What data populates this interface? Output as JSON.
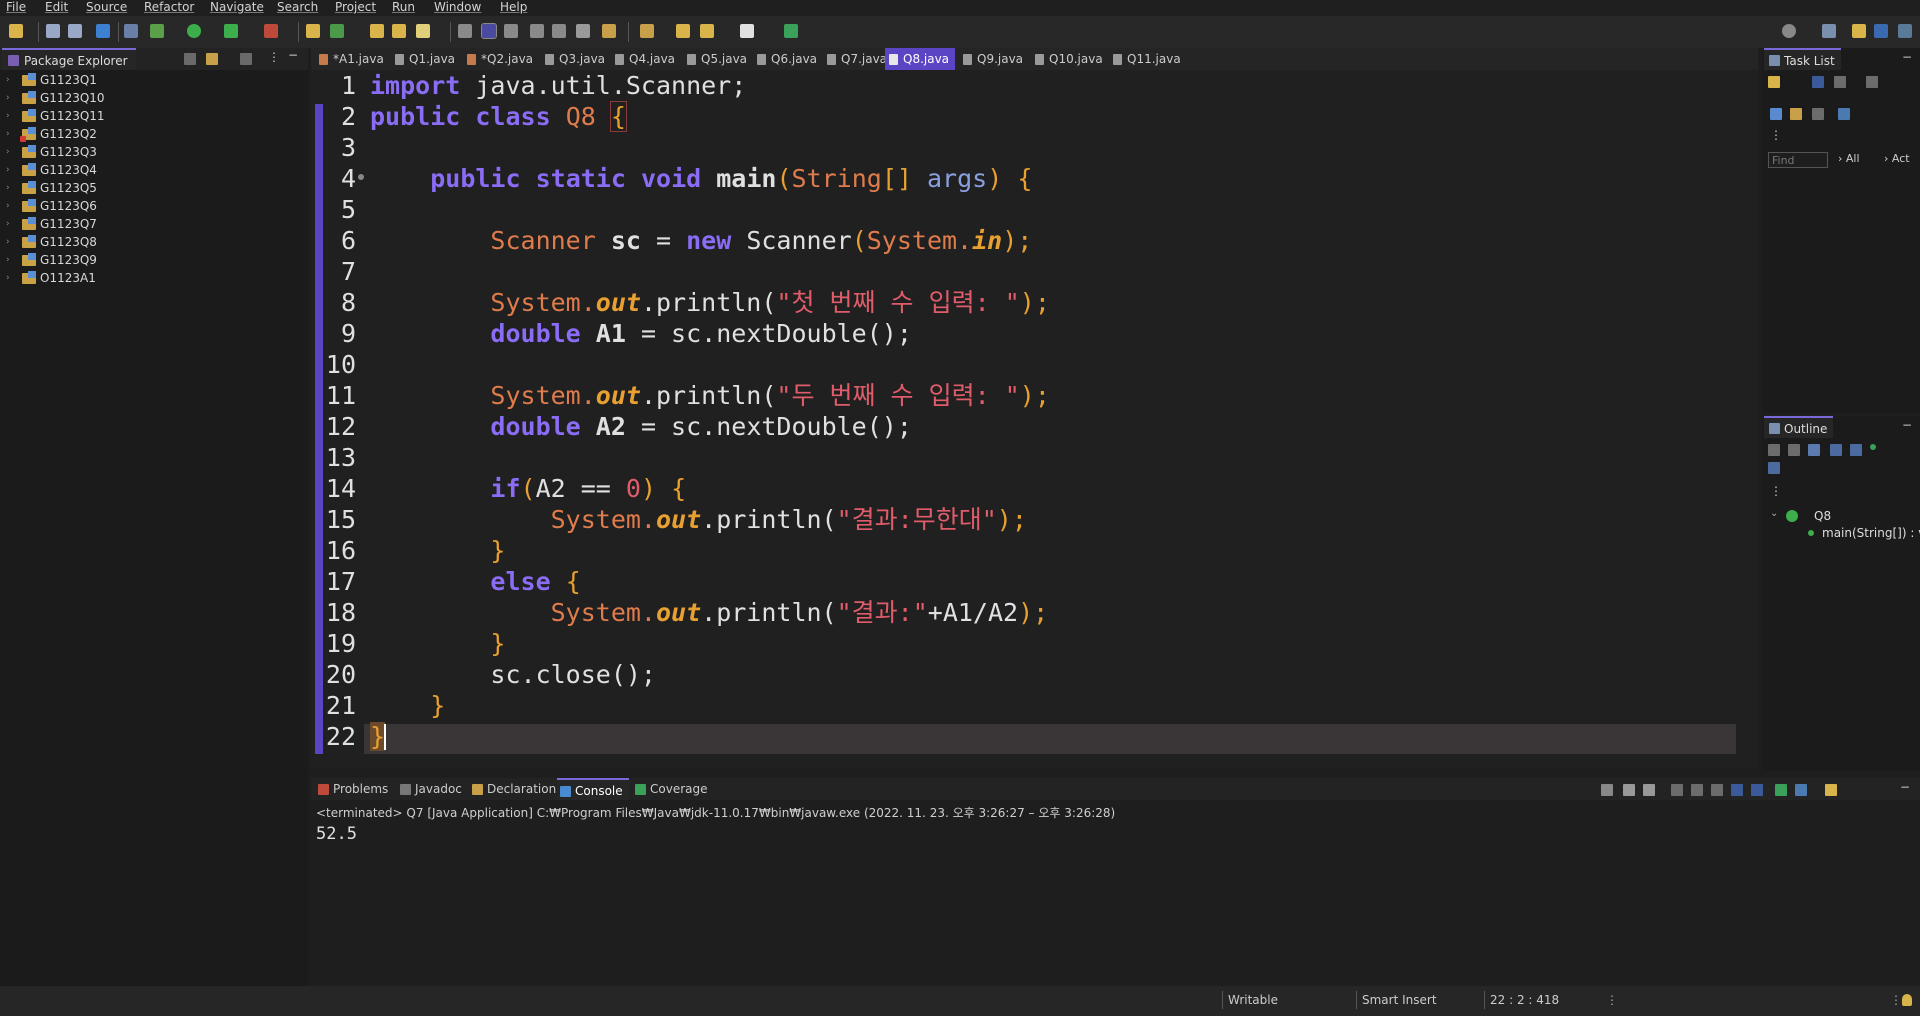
{
  "menu": [
    "File",
    "Edit",
    "Source",
    "Refactor",
    "Navigate",
    "Search",
    "Project",
    "Run",
    "Window",
    "Help"
  ],
  "package_explorer": {
    "title": "Package Explorer",
    "projects": [
      "G1123Q1",
      "G1123Q10",
      "G1123Q11",
      "G1123Q2",
      "G1123Q3",
      "G1123Q4",
      "G1123Q5",
      "G1123Q6",
      "G1123Q7",
      "G1123Q8",
      "G1123Q9",
      "O1123A1"
    ]
  },
  "editor": {
    "tabs": [
      "*A1.java",
      "Q1.java",
      "*Q2.java",
      "Q3.java",
      "Q4.java",
      "Q5.java",
      "Q6.java",
      "Q7.java",
      "Q8.java",
      "Q9.java",
      "Q10.java",
      "Q11.java"
    ],
    "active_tab": "Q8.java",
    "line_numbers": [
      "1",
      "2",
      "3",
      "4",
      "5",
      "6",
      "7",
      "8",
      "9",
      "10",
      "11",
      "12",
      "13",
      "14",
      "15",
      "16",
      "17",
      "18",
      "19",
      "20",
      "21",
      "22"
    ],
    "code": {
      "l1_kw": "import",
      "l1_rest": " java.util.Scanner;",
      "l2_kw1": "public",
      "l2_kw2": "class",
      "l2_name": "Q8",
      "l2_brace": "{",
      "l4_kw1": "public",
      "l4_kw2": "static",
      "l4_kw3": "void",
      "l4_name": "main",
      "l4_open": "(",
      "l4_type": "String",
      "l4_arr": "[] ",
      "l4_arg": "args",
      "l4_close": ") {",
      "l6_type": "Scanner",
      "l6_var": "sc",
      "l6_eq": " = ",
      "l6_new": "new",
      "l6_type2": "Scanner",
      "l6_open": "(",
      "l6_sys": "System.",
      "l6_in": "in",
      "l6_close": ");",
      "l8_sys": "System.",
      "l8_out": "out",
      "l8_m": ".println(",
      "l8_str": "\"첫 번째 수 입력: \"",
      "l8_end": ");",
      "l9_kw": "double",
      "l9_var": "A1",
      "l9_rest": " = sc.nextDouble();",
      "l11_sys": "System.",
      "l11_out": "out",
      "l11_m": ".println(",
      "l11_str": "\"두 번째 수 입력: \"",
      "l11_end": ");",
      "l12_kw": "double",
      "l12_var": "A2",
      "l12_rest": " = sc.nextDouble();",
      "l14_kw": "if",
      "l14_open": "(",
      "l14_cond": "A2 == ",
      "l14_num": "0",
      "l14_close": ") {",
      "l15_sys": "System.",
      "l15_out": "out",
      "l15_m": ".println(",
      "l15_str": "\"결과:무한대\"",
      "l15_end": ");",
      "l16": "}",
      "l17_kw": "else",
      "l17_brace": " {",
      "l18_sys": "System.",
      "l18_out": "out",
      "l18_m": ".println(",
      "l18_str": "\"결과:\"",
      "l18_expr": "+A1/A2",
      "l18_end": ");",
      "l19": "}",
      "l20": "sc.close();",
      "l21": "}",
      "l22": "}"
    }
  },
  "task_list": {
    "title": "Task List",
    "find_placeholder": "Find",
    "all": "All",
    "act": "Act"
  },
  "outline": {
    "title": "Outline",
    "class": "Q8",
    "method": "main(String[]) : v"
  },
  "console": {
    "tabs": [
      "Problems",
      "Javadoc",
      "Declaration",
      "Console",
      "Coverage"
    ],
    "active": "Console",
    "description": "<terminated> Q7 [Java Application] C:₩Program Files₩Java₩jdk-11.0.17₩bin₩javaw.exe  (2022. 11. 23. 오후 3:26:27 – 오후 3:26:28)",
    "output": "52.5"
  },
  "status": {
    "writable": "Writable",
    "insert": "Smart Insert",
    "position": "22 : 2 : 418"
  },
  "colors": {
    "accent": "#5b45c4",
    "keyword": "#8a6cf5",
    "type": "#e07c4c",
    "string": "#e05c6a",
    "brace": "#e8a030"
  }
}
